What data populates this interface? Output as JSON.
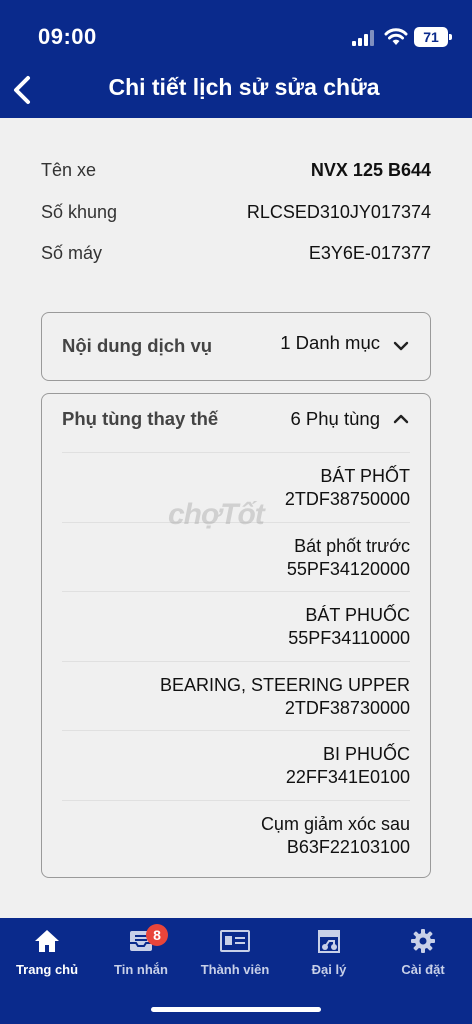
{
  "status": {
    "time": "09:00",
    "battery": "71"
  },
  "header": {
    "title": "Chi tiết lịch sử sửa chữa"
  },
  "vehicle": [
    {
      "label": "Tên xe",
      "value": "NVX 125 B644"
    },
    {
      "label": "Số khung",
      "value": "RLCSED310JY017374"
    },
    {
      "label": "Số máy",
      "value": "E3Y6E-017377"
    }
  ],
  "services": {
    "label": "Nội dung dịch vụ",
    "count": "1 Danh mục"
  },
  "parts": {
    "label": "Phụ tùng thay thế",
    "count": "6 Phụ tùng",
    "items": [
      {
        "name": "BÁT PHỐT",
        "code": "2TDF38750000"
      },
      {
        "name": "Bát phốt trước",
        "code": "55PF34120000"
      },
      {
        "name": "BÁT PHUỐC",
        "code": "55PF34110000"
      },
      {
        "name": "BEARING, STEERING UPPER",
        "code": "2TDF38730000"
      },
      {
        "name": "BI PHUỐC",
        "code": "22FF341E0100"
      },
      {
        "name": "Cụm giảm xóc sau",
        "code": "B63F22103100"
      }
    ]
  },
  "watermark": "chợTốt",
  "tabbar": {
    "tabs": [
      {
        "label": "Trang chủ",
        "icon": "home-icon"
      },
      {
        "label": "Tin nhắn",
        "icon": "inbox-icon",
        "badge": "8"
      },
      {
        "label": "Thành viên",
        "icon": "member-card-icon"
      },
      {
        "label": "Đại lý",
        "icon": "dealer-icon"
      },
      {
        "label": "Cài đặt",
        "icon": "gear-icon"
      }
    ]
  },
  "colors": {
    "primary": "#0a2a8c",
    "badge": "#e8453a",
    "background": "#f0f0f0"
  }
}
